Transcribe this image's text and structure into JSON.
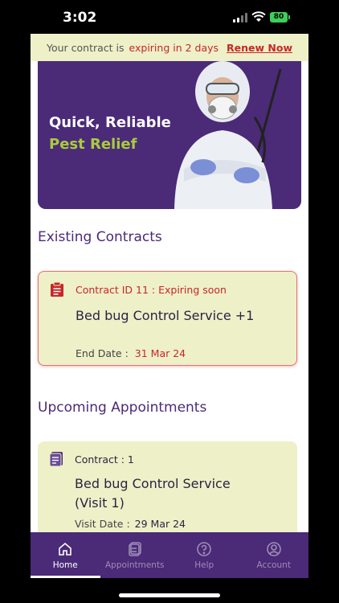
{
  "status_bar": {
    "time": "3:02",
    "battery": "80"
  },
  "contract_banner": {
    "text": "Your contract is",
    "warning": "expiring in 2 days",
    "action": "Renew Now"
  },
  "hero": {
    "line1": "Quick, Reliable",
    "line2": "Pest Relief",
    "accent_color": "#a8cc3c"
  },
  "existing_contracts": {
    "title": "Existing Contracts",
    "items": [
      {
        "meta": "Contract ID 11 : Expiring soon",
        "service": "Bed bug Control Service +1",
        "end_label": "End Date :",
        "end_date": "31 Mar 24",
        "icon": "clipboard-icon"
      }
    ]
  },
  "upcoming_appointments": {
    "title": "Upcoming Appointments",
    "items": [
      {
        "contract": "Contract : 1",
        "service_line1": "Bed bug Control Service",
        "service_line2": "(Visit 1)",
        "visit_label": "Visit Date :",
        "visit_date": "29 Mar 24",
        "icon": "document-icon"
      }
    ]
  },
  "tabs": [
    {
      "label": "Home",
      "icon": "home-icon",
      "active": true
    },
    {
      "label": "Appointments",
      "icon": "appointments-icon",
      "active": false
    },
    {
      "label": "Help",
      "icon": "help-icon",
      "active": false
    },
    {
      "label": "Account",
      "icon": "account-icon",
      "active": false
    }
  ],
  "colors": {
    "brand_purple": "#4b2a78",
    "card_bg": "#eef0c8",
    "warning_red": "#c62828"
  }
}
